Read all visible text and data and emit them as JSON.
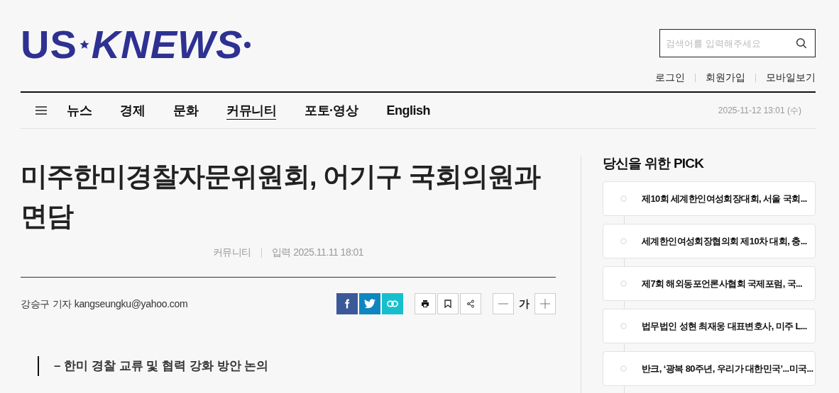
{
  "logo": {
    "left": "US",
    "right": "KNEWS"
  },
  "search": {
    "placeholder": "검색어를 입력해주세요"
  },
  "top_links": [
    "로그인",
    "회원가입",
    "모바일보기"
  ],
  "nav": {
    "items": [
      {
        "label": "뉴스",
        "selected": false
      },
      {
        "label": "경제",
        "selected": false
      },
      {
        "label": "문화",
        "selected": false
      },
      {
        "label": "커뮤니티",
        "selected": true
      },
      {
        "label": "포토·영상",
        "selected": false
      },
      {
        "label": "English",
        "selected": false
      }
    ],
    "date": "2025-11-12 13:01 (수)"
  },
  "article": {
    "title": "미주한미경찰자문위원회, 어기구 국회의원과 면담",
    "section": "커뮤니티",
    "published": "입력 2025.11.11 18:01",
    "byline": "강승구 기자 kangseungku@yahoo.com",
    "font_size_label": "가",
    "subtitle": "– 한미 경찰 교류 및 협력 강화 방안 논의"
  },
  "sidebar": {
    "title": "당신을 위한 PICK",
    "items": [
      "제10회 세계한인여성회장대회, 서울 국회...",
      "세계한인여성회장협의회 제10차 대회, 충...",
      "제7회 해외동포언론사협회 국제포럼, 국...",
      "법무법인 성현 최재웅 대표변호사, 미주 L...",
      "반크, ‘광복 80주년, 우리가 대한민국’...미국..."
    ]
  }
}
